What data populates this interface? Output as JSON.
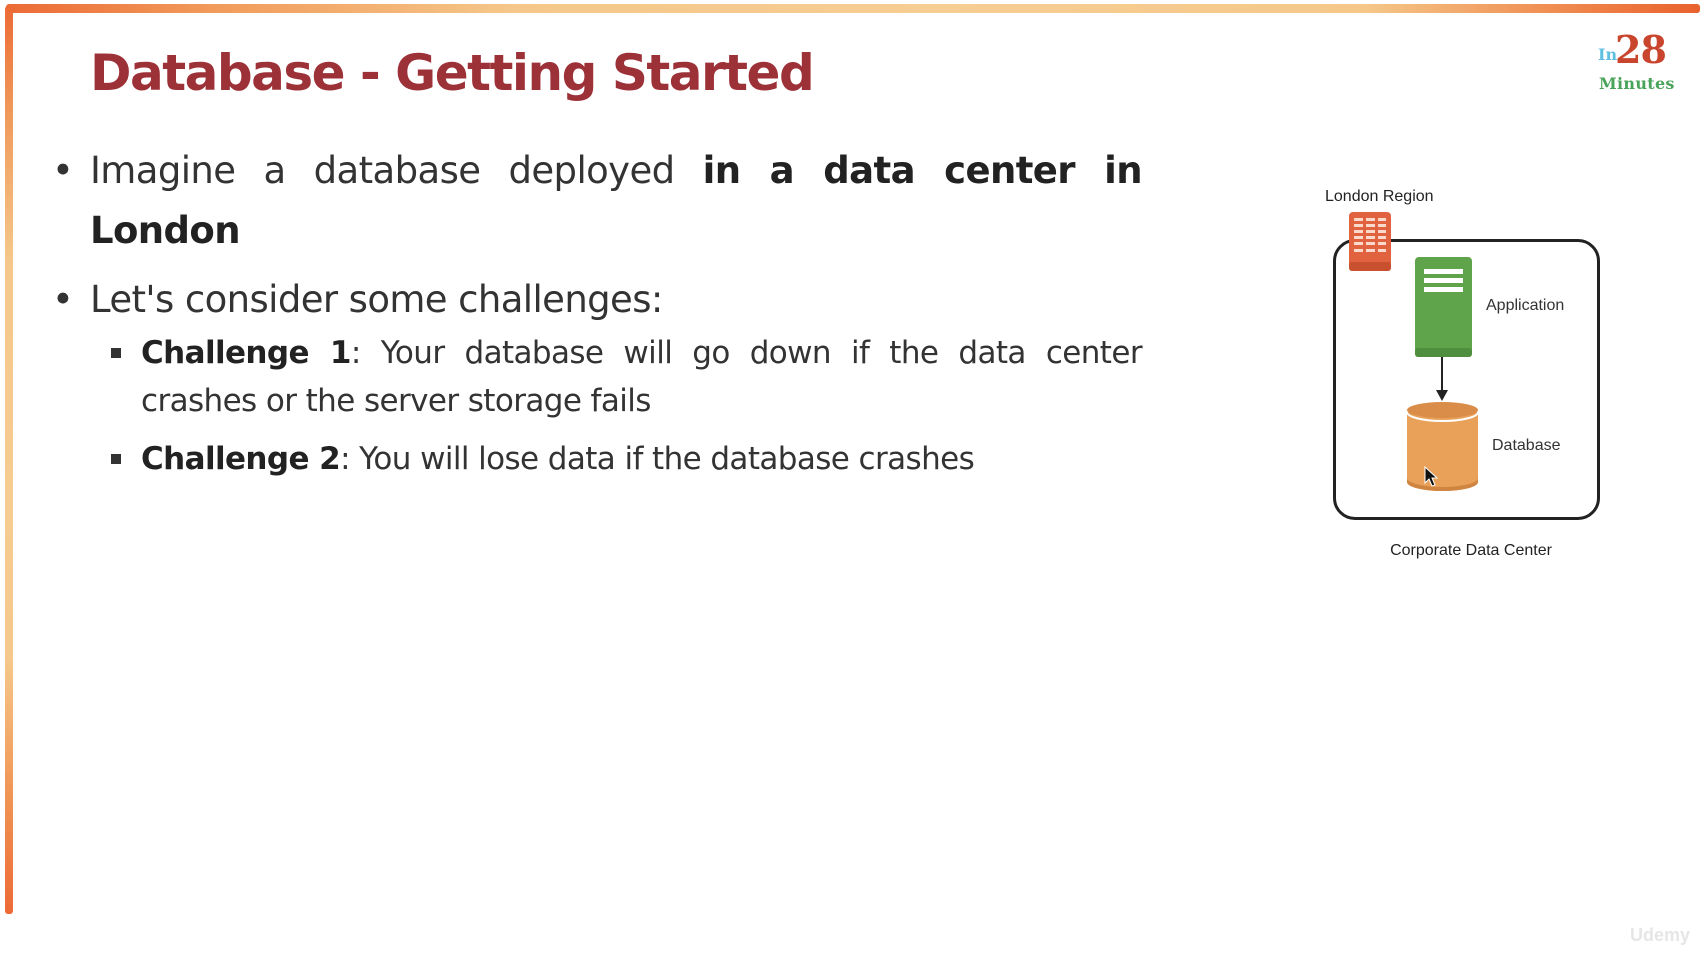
{
  "slide": {
    "title": "Database - Getting Started",
    "logo": {
      "prefix": "In",
      "number": "28",
      "suffix": "Minutes",
      "colors": {
        "prefix": "#5fbfe0",
        "number": "#c9452e",
        "suffix": "#4aa35a"
      }
    },
    "accent_colors": {
      "title": "#9d3138",
      "frame_orange": "#ec6a35",
      "frame_peach": "#f5c88a"
    },
    "bullets": [
      {
        "segments": [
          {
            "text": "Imagine a database deployed ",
            "bold": false
          },
          {
            "text": "in a data center in London",
            "bold": true
          }
        ]
      },
      {
        "segments": [
          {
            "text": "Let's consider some challenges:",
            "bold": false
          }
        ],
        "sub_bullets": [
          {
            "segments": [
              {
                "text": "Challenge 1",
                "bold": true
              },
              {
                "text": ": Your database will go down if the data center crashes or the server storage fails",
                "bold": false
              }
            ]
          },
          {
            "segments": [
              {
                "text": "Challenge 2",
                "bold": true
              },
              {
                "text": ": You will lose data if the database crashes",
                "bold": false
              }
            ]
          }
        ]
      }
    ]
  },
  "diagram": {
    "region_label": "London Region",
    "region_icon": "building-icon",
    "container_label": "Corporate Data Center",
    "nodes": [
      {
        "label": "Application",
        "icon": "server-icon",
        "color": "#5fa44a"
      },
      {
        "label": "Database",
        "icon": "database-cylinder-icon",
        "color": "#e9a15a"
      }
    ],
    "edges": [
      {
        "from": "Application",
        "to": "Database"
      }
    ],
    "colors": {
      "region_icon": "#e0623f",
      "frame": "#222222"
    }
  },
  "watermark": "Udemy"
}
